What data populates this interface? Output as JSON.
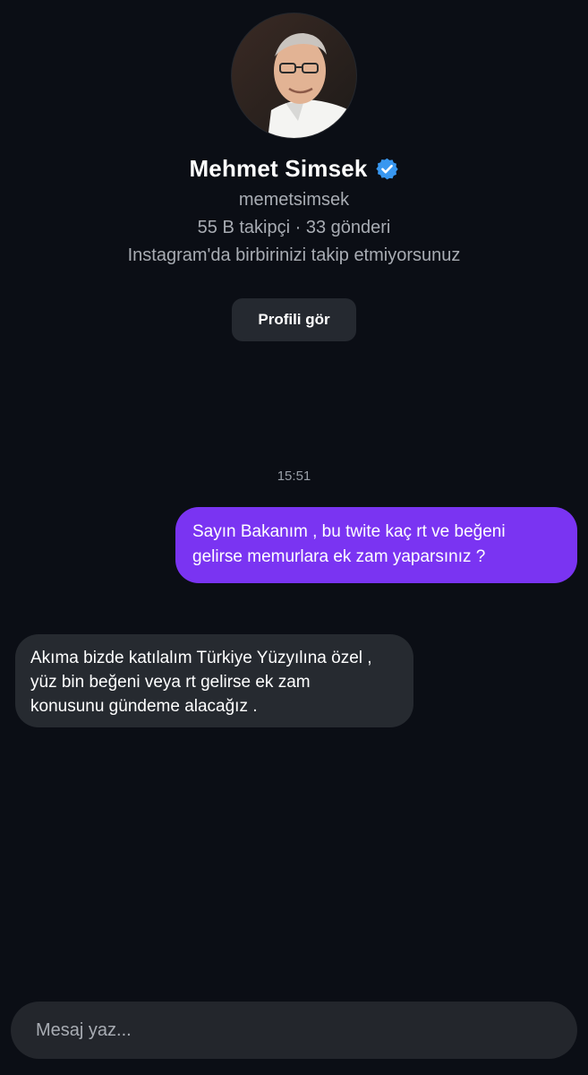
{
  "profile": {
    "name": "Mehmet Simsek",
    "verified_icon": "verified-badge-icon",
    "username": "memetsimsek",
    "stats": "55 B takipçi · 33 gönderi",
    "follow_note": "Instagram'da birbirinizi takip etmiyorsunuz",
    "view_profile_label": "Profili gör"
  },
  "conversation": {
    "timestamp": "15:51",
    "messages": [
      {
        "direction": "sent",
        "lines": [
          "Sayın Bakanım , bu twite kaç rt ve beğeni",
          "gelirse memurlara ek zam yaparsınız ?"
        ]
      },
      {
        "direction": "received",
        "lines": [
          "Akıma bizde katılalım Türkiye Yüzyılına özel ,",
          "yüz bin beğeni veya rt gelirse ek zam",
          "konusunu gündeme alacağız ."
        ]
      }
    ]
  },
  "composer": {
    "placeholder": "Mesaj yaz..."
  },
  "colors": {
    "background": "#0b0e15",
    "sent_bubble": "#7a34f2",
    "received_bubble": "#262a30",
    "verified_blue": "#3897f0"
  }
}
